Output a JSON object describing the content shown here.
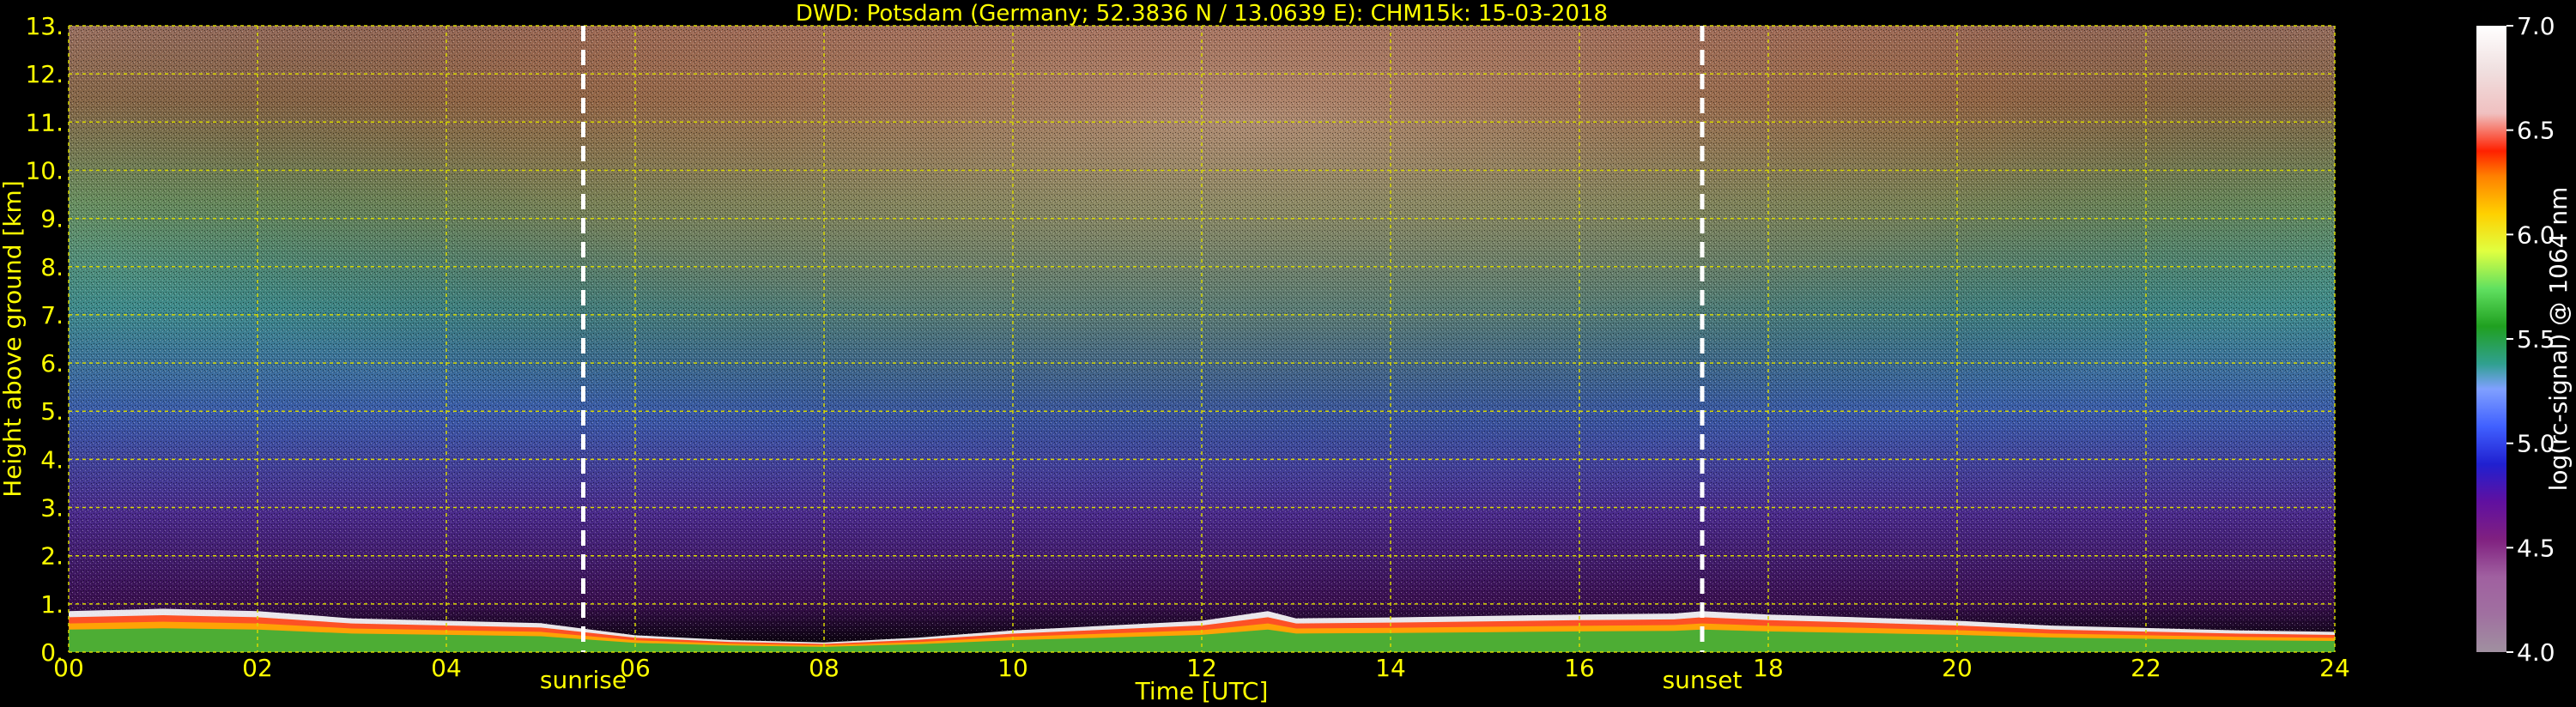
{
  "title": "DWD: Potsdam (Germany; 52.3836 N / 13.0639 E):    CHM15k: 15-03-2018",
  "chart_data": {
    "type": "heatmap",
    "title": "DWD: Potsdam (Germany; 52.3836 N / 13.0639 E):    CHM15k: 15-03-2018",
    "xlabel": "Time [UTC]",
    "ylabel": "Height above ground [km]",
    "xlim": [
      0,
      24
    ],
    "ylim": [
      0,
      13
    ],
    "x_ticks": [
      "00",
      "02",
      "04",
      "06",
      "08",
      "10",
      "12",
      "14",
      "16",
      "18",
      "20",
      "22",
      "24"
    ],
    "y_ticks": [
      "0.",
      "1.",
      "2.",
      "3.",
      "4.",
      "5.",
      "6.",
      "7.",
      "8.",
      "9.",
      "10.",
      "11.",
      "12.",
      "13."
    ],
    "grid": true,
    "vlines": [
      {
        "x": 5.45,
        "label": "sunrise"
      },
      {
        "x": 17.3,
        "label": "sunset"
      }
    ],
    "colorbar": {
      "label": "log(rc-signal) @ 1064 nm",
      "range": [
        4.0,
        7.0
      ],
      "ticks": [
        "4.0",
        "4.5",
        "5.0",
        "5.5",
        "6.0",
        "6.5",
        "7.0"
      ]
    },
    "layer_profile": {
      "hours": [
        0,
        1,
        2,
        3,
        4,
        5,
        6,
        7,
        8,
        9,
        10,
        11,
        12,
        12.7,
        13,
        14,
        15,
        16,
        17,
        17.3,
        18,
        19,
        20,
        21,
        22,
        23,
        24
      ],
      "top_km": [
        0.85,
        0.9,
        0.85,
        0.7,
        0.65,
        0.6,
        0.35,
        0.25,
        0.2,
        0.3,
        0.45,
        0.55,
        0.65,
        0.85,
        0.7,
        0.72,
        0.75,
        0.78,
        0.8,
        0.85,
        0.78,
        0.72,
        0.65,
        0.55,
        0.5,
        0.45,
        0.42
      ]
    }
  }
}
